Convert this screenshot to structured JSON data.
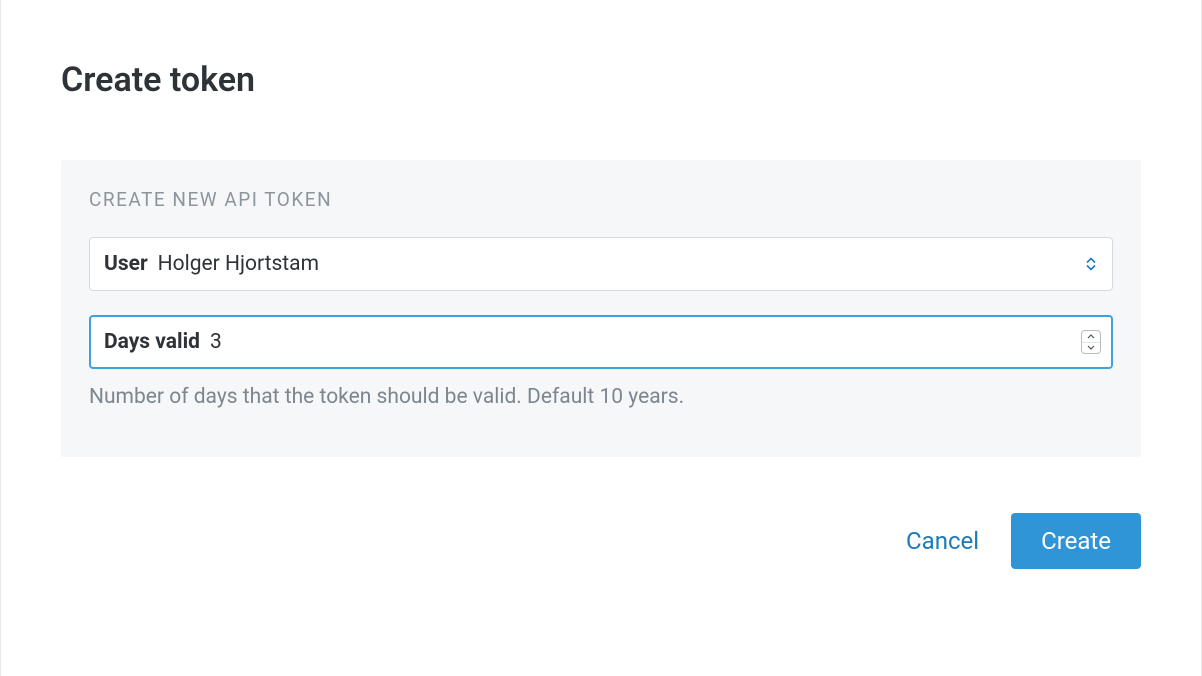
{
  "page": {
    "title": "Create token"
  },
  "panel": {
    "title": "CREATE NEW API TOKEN",
    "user_field": {
      "label": "User",
      "value": "Holger Hjortstam"
    },
    "days_field": {
      "label": "Days valid",
      "value": "3",
      "help": "Number of days that the token should be valid. Default 10 years."
    }
  },
  "actions": {
    "cancel": "Cancel",
    "create": "Create"
  }
}
